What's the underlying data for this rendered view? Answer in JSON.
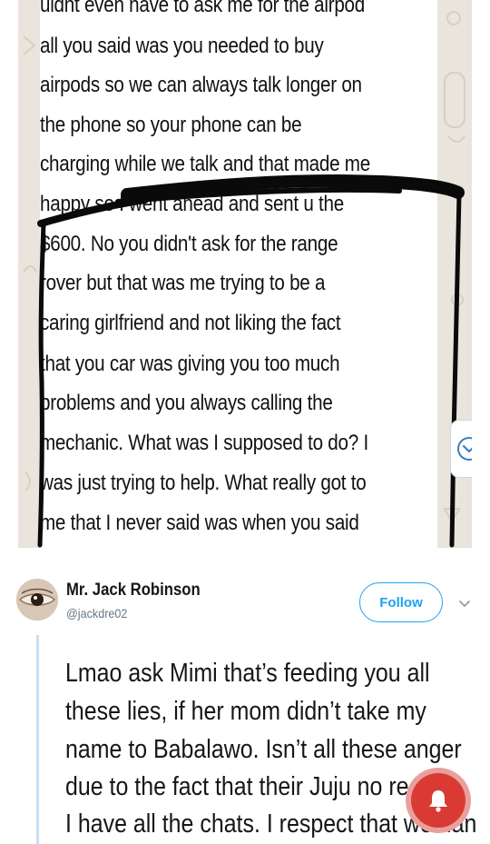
{
  "chat": {
    "lines": [
      "uidnt even nave to ask me for the airpod",
      "all you said was you needed to buy",
      "airpods so we can always talk longer on",
      "the phone so your phone can be",
      "charging while we talk and that made me",
      "happy so I went ahead and sent u the",
      "$600. No you didn't ask for the range",
      "rover but that was me trying to be a",
      "caring girlfriend and not liking the fact",
      "that you car was giving you too much",
      "problems and you always calling the",
      "mechanic. What was I supposed to do? I",
      "was just trying to help. What really got to",
      "me that I never said was when you said"
    ],
    "scroll_icon": "chevron-down-icon"
  },
  "tweet": {
    "display_name": "Mr. Jack Robinson",
    "handle": "@jackdre02",
    "follow_label": "Follow",
    "lines": [
      "Lmao ask Mimi that’s feeding you all",
      "these lies, if her mom didn’t take my",
      "name to Babalawo. Isn’t all these anger",
      "due to the fact that their Juju no rea",
      "I have all the chats. I respect that woman"
    ],
    "notification_icon": "bell-icon"
  },
  "colors": {
    "accent": "#1da1f2",
    "thread": "#c9def2",
    "notification": "#d93a34",
    "chat_background": "#e9e4dc"
  }
}
